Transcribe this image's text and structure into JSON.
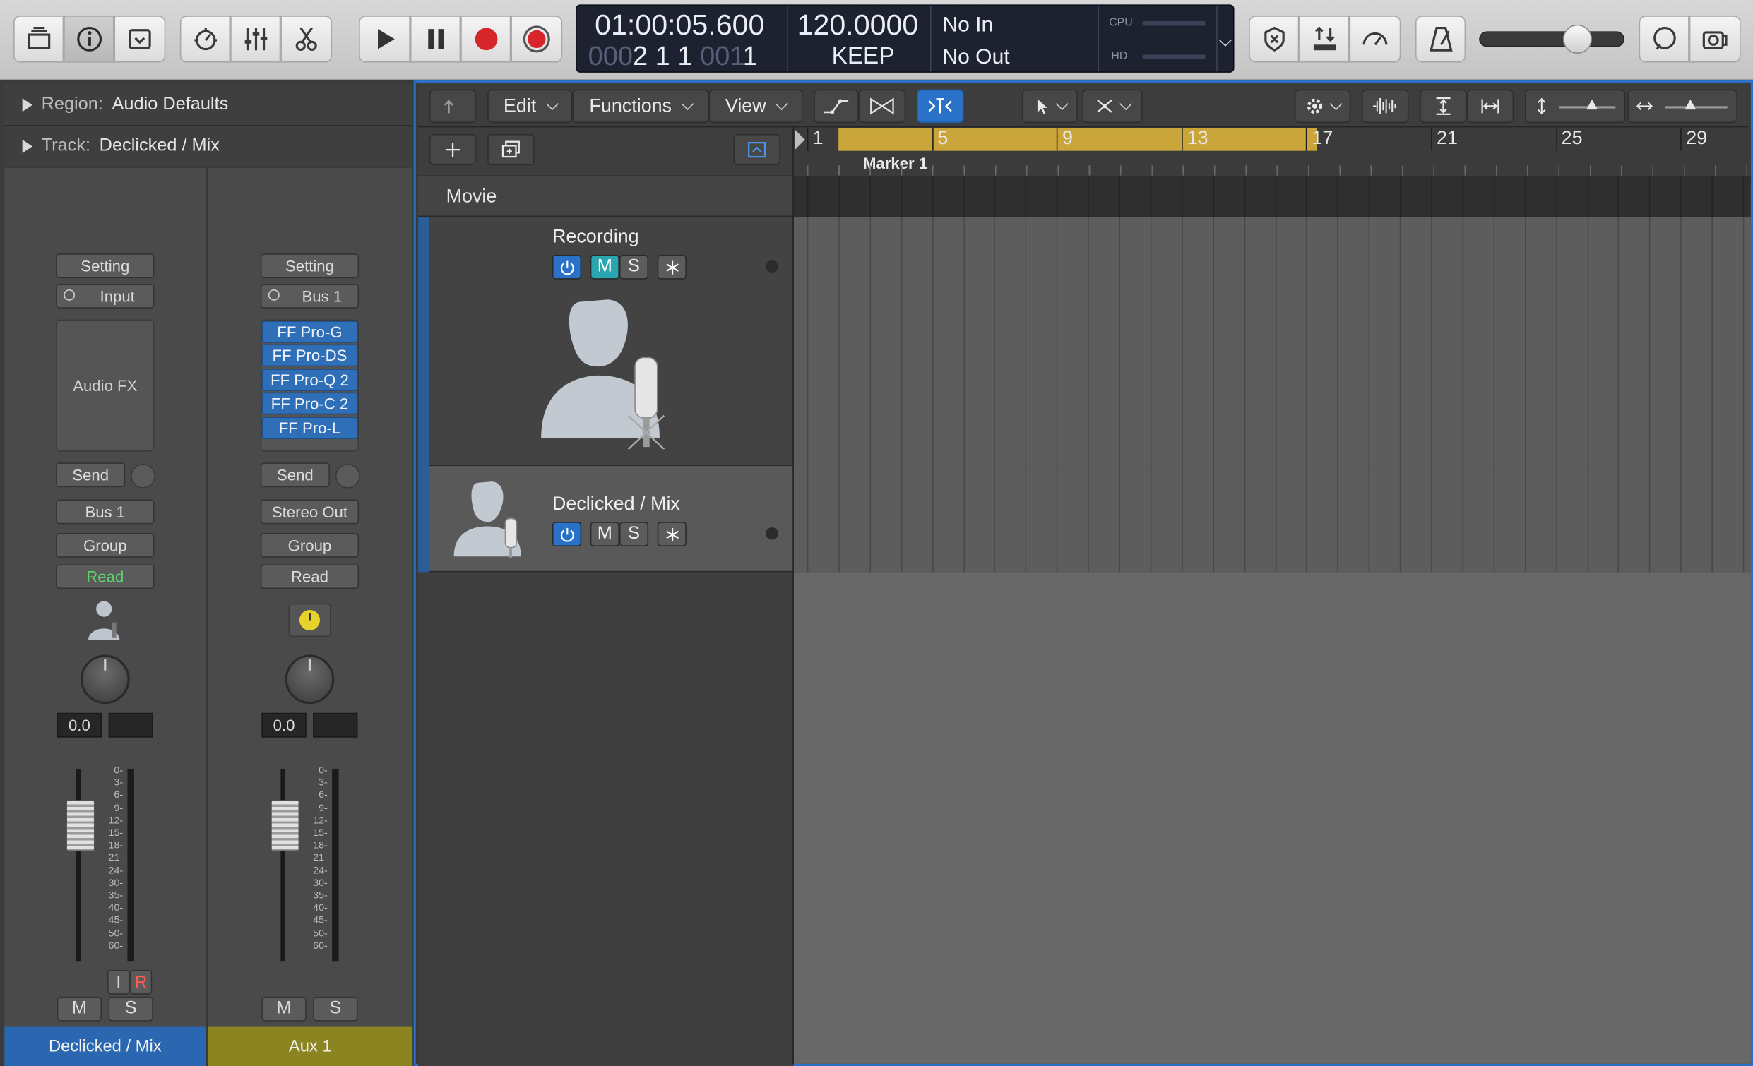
{
  "transport": {
    "time": "01:00:05.600",
    "bars": "2  1  1",
    "bars_dim_prefix": "000",
    "bars_dim_mid": "001",
    "bars_end": "1",
    "tempo": "120.0000",
    "tempo_mode": "KEEP",
    "in_label": "No In",
    "out_label": "No Out",
    "cpu_label": "CPU",
    "hd_label": "HD"
  },
  "inspector": {
    "region_key": "Region:",
    "region_value": "Audio Defaults",
    "track_key": "Track:",
    "track_value": "Declicked / Mix"
  },
  "strip1": {
    "setting": "Setting",
    "input": "Input",
    "audio_fx": "Audio FX",
    "send": "Send",
    "output": "Bus 1",
    "group": "Group",
    "automation": "Read",
    "volume": "0.0",
    "btn_i": "I",
    "btn_r": "R",
    "mute": "M",
    "solo": "S",
    "name": "Declicked / Mix",
    "name_color": "#2a67b0"
  },
  "strip2": {
    "setting": "Setting",
    "input": "Bus 1",
    "plugins": [
      "FF Pro-G",
      "FF Pro-DS",
      "FF Pro-Q 2",
      "FF Pro-C 2",
      "FF Pro-L"
    ],
    "send": "Send",
    "output": "Stereo Out",
    "group": "Group",
    "automation": "Read",
    "volume": "0.0",
    "mute": "M",
    "solo": "S",
    "name": "Aux 1",
    "name_color": "#8a8520"
  },
  "meter_scale": [
    "0",
    "3",
    "6",
    "9",
    "12",
    "15",
    "18",
    "21",
    "24",
    "30",
    "35",
    "40",
    "45",
    "50",
    "60"
  ],
  "menus": {
    "edit": "Edit",
    "functions": "Functions",
    "view": "View"
  },
  "ruler": {
    "bars": [
      "1",
      "5",
      "9",
      "13",
      "17",
      "21",
      "25",
      "29"
    ],
    "marker": "Marker 1",
    "cycle_color": "#c9a53a"
  },
  "movie_label": "Movie",
  "tracks": [
    {
      "name": "Recording",
      "mute": "M",
      "solo": "S"
    },
    {
      "name": "Declicked / Mix",
      "mute": "M",
      "solo": "S"
    }
  ],
  "colors": {
    "accent": "#2a72c8",
    "record": "#d7262b"
  }
}
